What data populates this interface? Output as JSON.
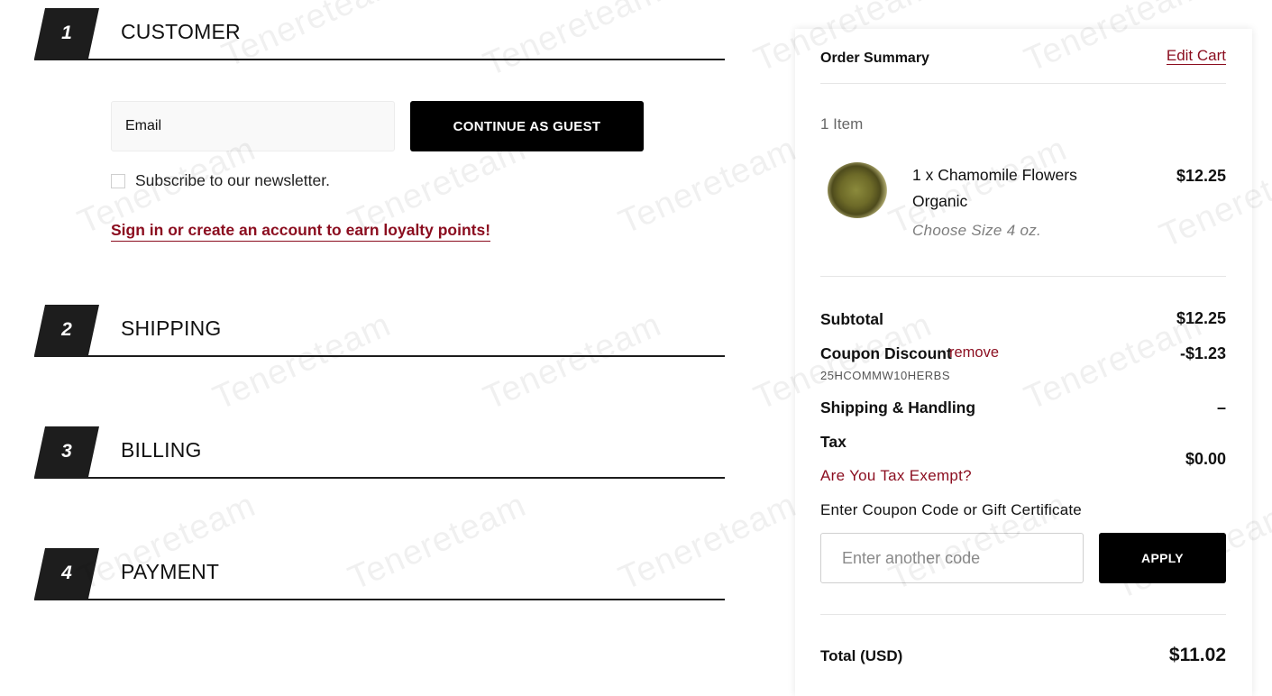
{
  "checkout": {
    "steps": [
      {
        "number": "1",
        "title": "CUSTOMER"
      },
      {
        "number": "2",
        "title": "SHIPPING"
      },
      {
        "number": "3",
        "title": "BILLING"
      },
      {
        "number": "4",
        "title": "PAYMENT"
      }
    ],
    "customer": {
      "email_placeholder": "Email",
      "continue_button": "CONTINUE AS GUEST",
      "newsletter_label": "Subscribe to our newsletter.",
      "newsletter_checked": false,
      "loyalty_link": "Sign in or create an account to earn loyalty points!"
    }
  },
  "summary": {
    "title": "Order Summary",
    "edit_cart": "Edit Cart",
    "item_count": "1 Item",
    "item": {
      "name": "1 x Chamomile Flowers Organic",
      "option": "Choose Size 4 oz.",
      "price": "$12.25"
    },
    "subtotal": {
      "label": "Subtotal",
      "value": "$12.25"
    },
    "coupon": {
      "label": "Coupon Discount",
      "remove": "remove",
      "code": "25HCOMMW10HERBS",
      "value": "-$1.23"
    },
    "shipping": {
      "label": "Shipping & Handling",
      "value": "–"
    },
    "tax": {
      "label": "Tax",
      "value": "$0.00",
      "exempt_link": "Are You Tax Exempt?"
    },
    "coupon_prompt": "Enter Coupon Code or Gift Certificate",
    "coupon_placeholder": "Enter another code",
    "apply_button": "APPLY",
    "total": {
      "label": "Total (USD)",
      "value": "$11.02"
    }
  },
  "watermark": "Tenereteam",
  "colors": {
    "accent": "#8b0d1f",
    "dark": "#1d1d1d",
    "button": "#000000"
  }
}
